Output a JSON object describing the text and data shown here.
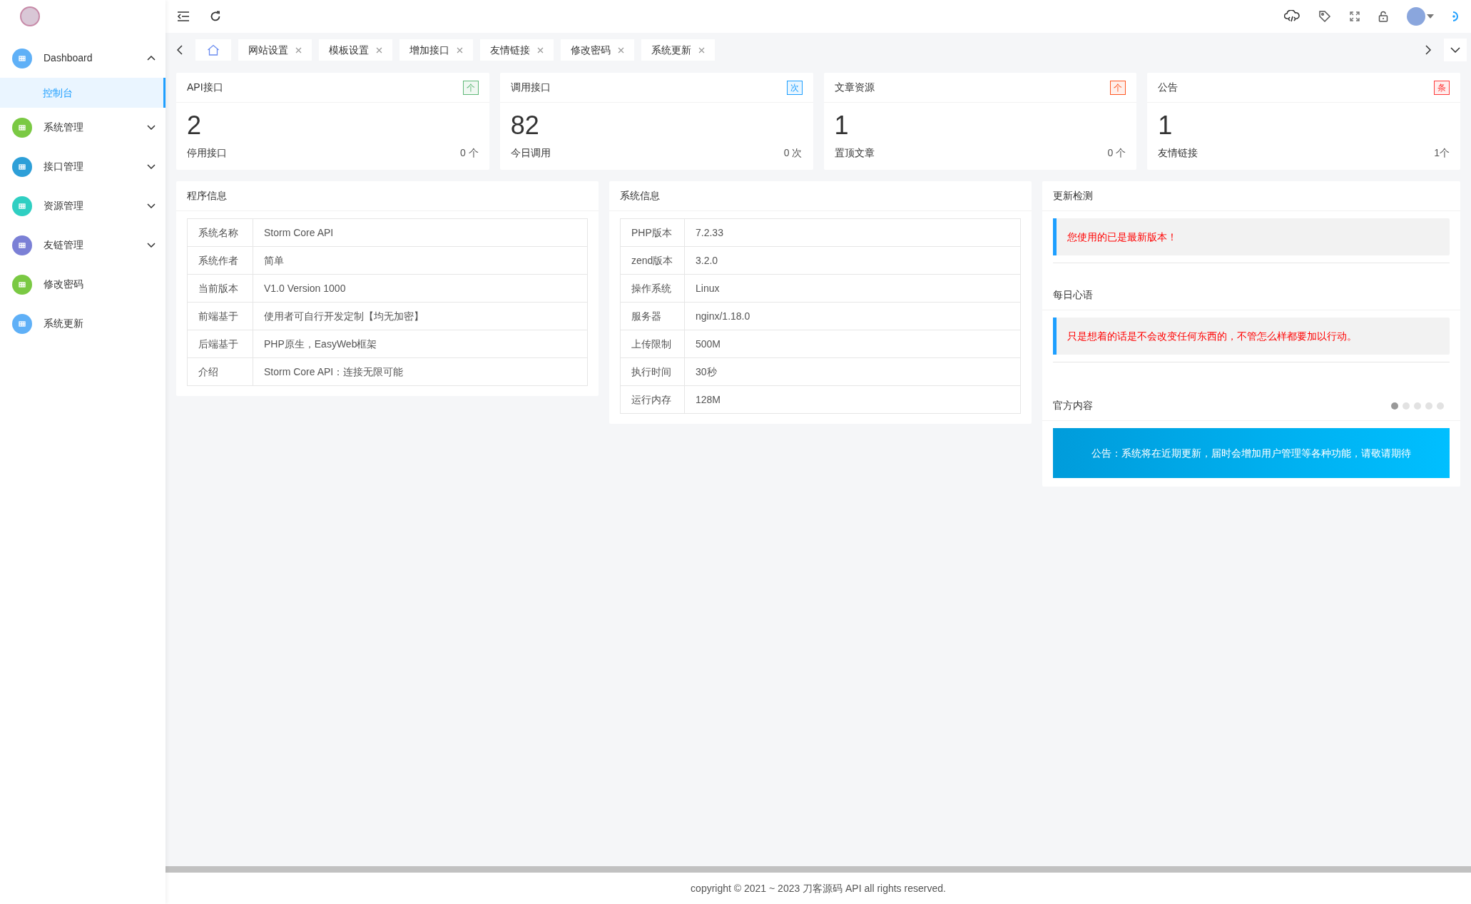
{
  "sidebar": {
    "items": [
      {
        "label": "Dashboard",
        "color": "#5fb0f7",
        "expanded": true,
        "children": [
          {
            "label": "控制台",
            "selected": true
          }
        ]
      },
      {
        "label": "系统管理",
        "color": "#7ac943",
        "expanded": false
      },
      {
        "label": "接口管理",
        "color": "#2d9fd8",
        "expanded": false
      },
      {
        "label": "资源管理",
        "color": "#2fcfc2",
        "expanded": false
      },
      {
        "label": "友链管理",
        "color": "#7b80d6",
        "expanded": false
      },
      {
        "label": "修改密码",
        "color": "#7ac943"
      },
      {
        "label": "系统更新",
        "color": "#5fb0f7"
      }
    ]
  },
  "tabs": [
    {
      "kind": "home",
      "selected": true
    },
    {
      "label": "网站设置",
      "selected": false
    },
    {
      "label": "模板设置",
      "selected": false
    },
    {
      "label": "增加接口",
      "selected": false
    },
    {
      "label": "友情链接",
      "selected": false
    },
    {
      "label": "修改密码",
      "selected": false
    },
    {
      "label": "系统更新",
      "selected": false
    }
  ],
  "stat_cards": [
    {
      "title": "API接口",
      "badge": "个",
      "color": "#5fb878",
      "value": "2",
      "caption": "停用接口",
      "count": "0 个"
    },
    {
      "title": "调用接口",
      "badge": "次",
      "color": "#1e9fff",
      "value": "82",
      "caption": "今日调用",
      "count": "0 次"
    },
    {
      "title": "文章资源",
      "badge": "个",
      "color": "#ff5722",
      "value": "1",
      "caption": "置顶文章",
      "count": "0 个"
    },
    {
      "title": "公告",
      "badge": "条",
      "color": "#ff3b3b",
      "value": "1",
      "caption": "友情链接",
      "count": "1个"
    }
  ],
  "program_info": {
    "title": "程序信息",
    "rows": [
      [
        "系统名称",
        "Storm Core API"
      ],
      [
        "系统作者",
        "简单"
      ],
      [
        "当前版本",
        "V1.0 Version 1000"
      ],
      [
        "前端基于",
        "使用者可自行开发定制【均无加密】"
      ],
      [
        "后端基于",
        "PHP原生，EasyWeb框架"
      ],
      [
        "介绍",
        "Storm Core API：连接无限可能"
      ]
    ]
  },
  "system_info": {
    "title": "系统信息",
    "rows": [
      [
        "PHP版本",
        "7.2.33"
      ],
      [
        "zend版本",
        "3.2.0"
      ],
      [
        "操作系统",
        "Linux"
      ],
      [
        "服务器",
        "nginx/1.18.0"
      ],
      [
        "上传限制",
        "500M"
      ],
      [
        "执行时间",
        "30秒"
      ],
      [
        "运行内存",
        "128M"
      ]
    ]
  },
  "update_check": {
    "title": "更新检测",
    "message": "您使用的已是最新版本！"
  },
  "daily_quote": {
    "title": "每日心语",
    "message": "只是想着的话是不会改变任何东西的，不管怎么样都要加以行动。"
  },
  "official": {
    "title": "官方内容",
    "dots": [
      {
        "selected": true
      },
      {
        "selected": false
      },
      {
        "selected": false
      },
      {
        "selected": false
      },
      {
        "selected": false
      }
    ],
    "banner": "公告：系统将在近期更新，届时会增加用户管理等各种功能，请敬请期待"
  },
  "footer": "copyright © 2021 ~ 2023 刀客源码 API all rights reserved."
}
